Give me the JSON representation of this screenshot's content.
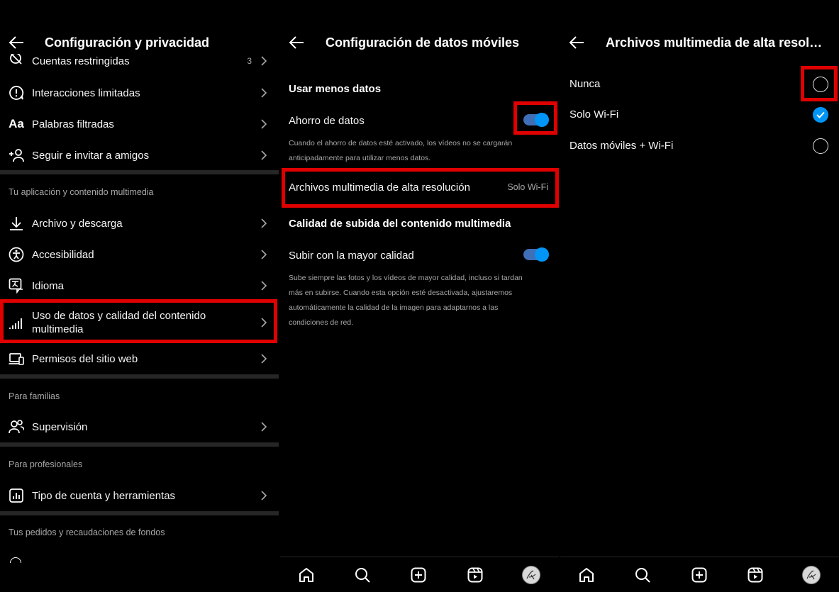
{
  "panel1": {
    "title": "Configuración y privacidad",
    "top_partial": {
      "label": "Cuentas restringidas",
      "count": "3"
    },
    "items_a": [
      {
        "label": "Interacciones limitadas",
        "icon": "alert-circle-icon"
      },
      {
        "label": "Palabras filtradas",
        "icon": "text-aa-icon",
        "icon_text": "Aa"
      },
      {
        "label": "Seguir e invitar a amigos",
        "icon": "add-user-icon"
      }
    ],
    "section_media": "Tu aplicación y contenido multimedia",
    "items_b": [
      {
        "label": "Archivo y descarga",
        "icon": "download-icon"
      },
      {
        "label": "Accesibilidad",
        "icon": "accessibility-icon"
      },
      {
        "label": "Idioma",
        "icon": "language-icon"
      },
      {
        "label": "Uso de datos y calidad del contenido multimedia",
        "icon": "signal-bars-icon"
      },
      {
        "label": "Permisos del sitio web",
        "icon": "devices-icon"
      }
    ],
    "section_families": "Para familias",
    "item_supervision": {
      "label": "Supervisión",
      "icon": "family-icon"
    },
    "section_pros": "Para profesionales",
    "item_tools": {
      "label": "Tipo de cuenta y herramientas",
      "icon": "chart-box-icon"
    },
    "section_orders": "Tus pedidos y recaudaciones de fondos"
  },
  "panel2": {
    "title": "Configuración de datos móviles",
    "section_less": "Usar menos datos",
    "data_saver_label": "Ahorro de datos",
    "data_saver_on": true,
    "data_saver_desc": "Cuando el ahorro de datos esté activado, los vídeos no se cargarán anticipadamente para utilizar menos datos.",
    "hires_label": "Archivos multimedia de alta resolución",
    "hires_value": "Solo Wi-Fi",
    "section_upload": "Calidad de subida del contenido multimedia",
    "upload_label": "Subir con la mayor calidad",
    "upload_on": true,
    "upload_desc": "Sube siempre las fotos y los vídeos de mayor calidad, incluso si tardan más en subirse. Cuando esta opción esté desactivada, ajustaremos automáticamente la calidad de la imagen para adaptarnos a las condiciones de red."
  },
  "panel3": {
    "title": "Archivos multimedia de alta resoluc...",
    "options": [
      {
        "label": "Nunca",
        "selected": false
      },
      {
        "label": "Solo Wi-Fi",
        "selected": true
      },
      {
        "label": "Datos móviles + Wi-Fi",
        "selected": false
      }
    ]
  },
  "nav": [
    "home-icon",
    "search-icon",
    "create-icon",
    "reels-icon",
    "profile-avatar"
  ],
  "colors": {
    "accent": "#0095f6",
    "highlight": "#e00000",
    "background": "#000000",
    "separator": "#262626"
  }
}
